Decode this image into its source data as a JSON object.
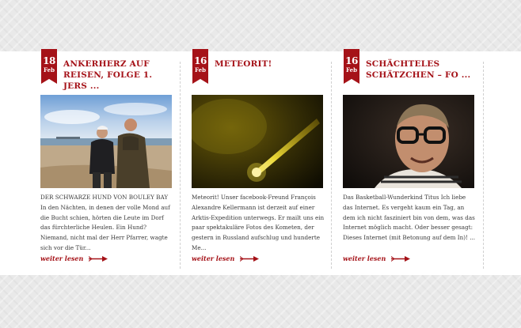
{
  "posts": [
    {
      "day": "18",
      "month": "Feb",
      "title": "Ankerherz auf\nReisen, Folge 1. Jers ...",
      "image": "photo of two men standing on a beach",
      "excerpt": "DER SCHWARZE HUND VON BOULEY BAY In den Nächten, in denen der volle Mond auf die Bucht schien, hörten die Leute im Dorf das fürchterliche Heulen. Ein Hund? Niemand, nicht mal der Herr Pfarrer, wagte sich vor die Tür...",
      "more_label": "weiter lesen",
      "more_icon": "arrow-right-icon"
    },
    {
      "day": "16",
      "month": "Feb",
      "title": "Meteorit!",
      "image": "photo of a glowing meteor streaking across a dark sky",
      "excerpt": "Meteorit! Unser facebook-Freund François Alexandre Kellermann ist derzeit auf einer Arktis-Expedition unterwegs. Er mailt uns ein paar spektakuläre Fotos des Kometen, der gestern in Russland aufschlug und hunderte Me...",
      "more_label": "weiter lesen",
      "more_icon": "arrow-right-icon"
    },
    {
      "day": "16",
      "month": "Feb",
      "title": "Schächteles\nSchätzchen – Fo ...",
      "image": "portrait of a smiling man with glasses",
      "excerpt": "Das Basketball-Wunderkind Titus Ich liebe das Internet. Es vergeht kaum ein Tag, an dem ich nicht fasziniert bin von dem, was das Internet möglich macht. Oder besser gesagt: Dieses Internet (mit Betonung auf dem In)! ...",
      "more_label": "weiter lesen",
      "more_icon": "arrow-right-icon"
    }
  ],
  "colors": {
    "accent": "#a51218",
    "text": "#3a3a3a",
    "background": "#e9e9e9",
    "panel": "#ffffff"
  }
}
